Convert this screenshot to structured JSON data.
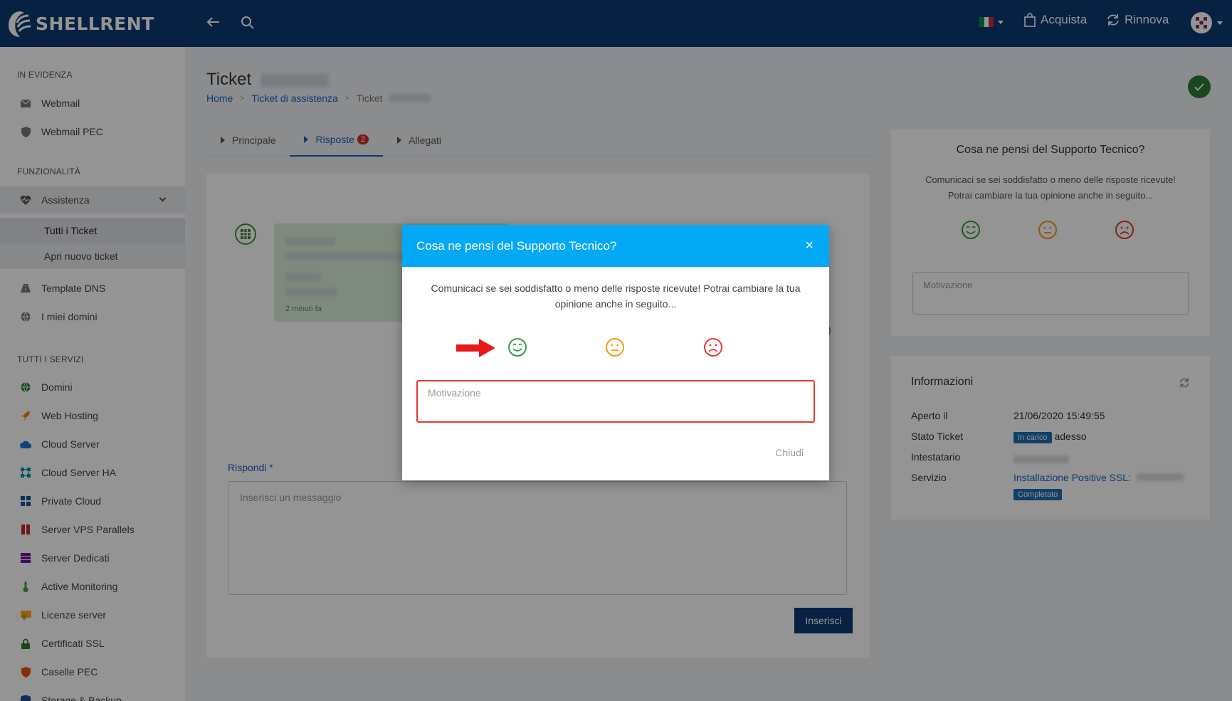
{
  "brand": {
    "name": "SHELLRENT"
  },
  "topbar": {
    "buy_label": "Acquista",
    "renew_label": "Rinnova"
  },
  "sidebar": {
    "sections": {
      "featured": "IN EVIDENZA",
      "features": "FUNZIONALITÀ",
      "services": "TUTTI I SERVIZI"
    },
    "featured": [
      {
        "label": "Webmail",
        "icon": "envelope-icon"
      },
      {
        "label": "Webmail PEC",
        "icon": "shield-icon"
      }
    ],
    "assistance": {
      "label": "Assistenza",
      "children": [
        "Tutti i Ticket",
        "Apri nuovo ticket"
      ]
    },
    "features": [
      {
        "label": "Template DNS",
        "icon": "road-icon"
      },
      {
        "label": "I miei domini",
        "icon": "globe-icon"
      }
    ],
    "services": [
      {
        "label": "Domini",
        "icon": "globe-icon",
        "color": "#2e7d32"
      },
      {
        "label": "Web Hosting",
        "icon": "rocket-icon",
        "color": "#f57c00"
      },
      {
        "label": "Cloud Server",
        "icon": "cloud-icon",
        "color": "#1976d2"
      },
      {
        "label": "Cloud Server HA",
        "icon": "network-icon",
        "color": "#0097a7"
      },
      {
        "label": "Private Cloud",
        "icon": "grid-icon",
        "color": "#1e4f9c"
      },
      {
        "label": "Server VPS Parallels",
        "icon": "parallels-icon",
        "color": "#c62828"
      },
      {
        "label": "Server Dedicati",
        "icon": "server-icon",
        "color": "#6a1b9a"
      },
      {
        "label": "Active Monitoring",
        "icon": "thermometer-icon",
        "color": "#43a047"
      },
      {
        "label": "Licenze server",
        "icon": "license-icon",
        "color": "#f9a825"
      },
      {
        "label": "Certificati SSL",
        "icon": "lock-icon",
        "color": "#2e7d32"
      },
      {
        "label": "Caselle PEC",
        "icon": "shield-icon",
        "color": "#e65100"
      },
      {
        "label": "Storage & Backup",
        "icon": "storage-icon",
        "color": "#1e4f9c"
      }
    ]
  },
  "page": {
    "title": "Ticket",
    "breadcrumb": [
      "Home",
      "Ticket di assistenza",
      "Ticket"
    ]
  },
  "tabs": [
    {
      "label": "Principale"
    },
    {
      "label": "Risposte",
      "badge": "2"
    },
    {
      "label": "Allegati"
    }
  ],
  "message": {
    "time": "2 minuti fa"
  },
  "reply": {
    "label": "Rispondi",
    "required_mark": "*",
    "placeholder": "Inserisci un messaggio",
    "submit_label": "Inserisci"
  },
  "rating_card": {
    "title": "Cosa ne pensi del Supporto Tecnico?",
    "text": "Comunicaci se sei soddisfatto o meno delle risposte ricevute! Potrai cambiare la tua opinione anche in seguito...",
    "placeholder": "Motivazione"
  },
  "info": {
    "title": "Informazioni",
    "rows": [
      {
        "label": "Aperto il",
        "value": "21/06/2020 15:49:55"
      },
      {
        "label": "Stato Ticket",
        "tag": "In carico",
        "value": "adesso"
      },
      {
        "label": "Intestatario"
      },
      {
        "label": "Servizio",
        "value": "Installazione Positive SSL:",
        "tag": "Completato"
      }
    ]
  },
  "modal": {
    "title": "Cosa ne pensi del Supporto Tecnico?",
    "close_icon": "×",
    "text": "Comunicaci se sei soddisfatto o meno delle risposte ricevute! Potrai cambiare la tua opinione anche in seguito...",
    "placeholder": "Motivazione",
    "close_label": "Chiudi"
  },
  "colors": {
    "brand": "#0d3a73",
    "modal_header": "#03a9f4",
    "happy": "#2e9e44",
    "neutral": "#f39c12",
    "sad": "#e53935",
    "highlight": "#e53935"
  }
}
